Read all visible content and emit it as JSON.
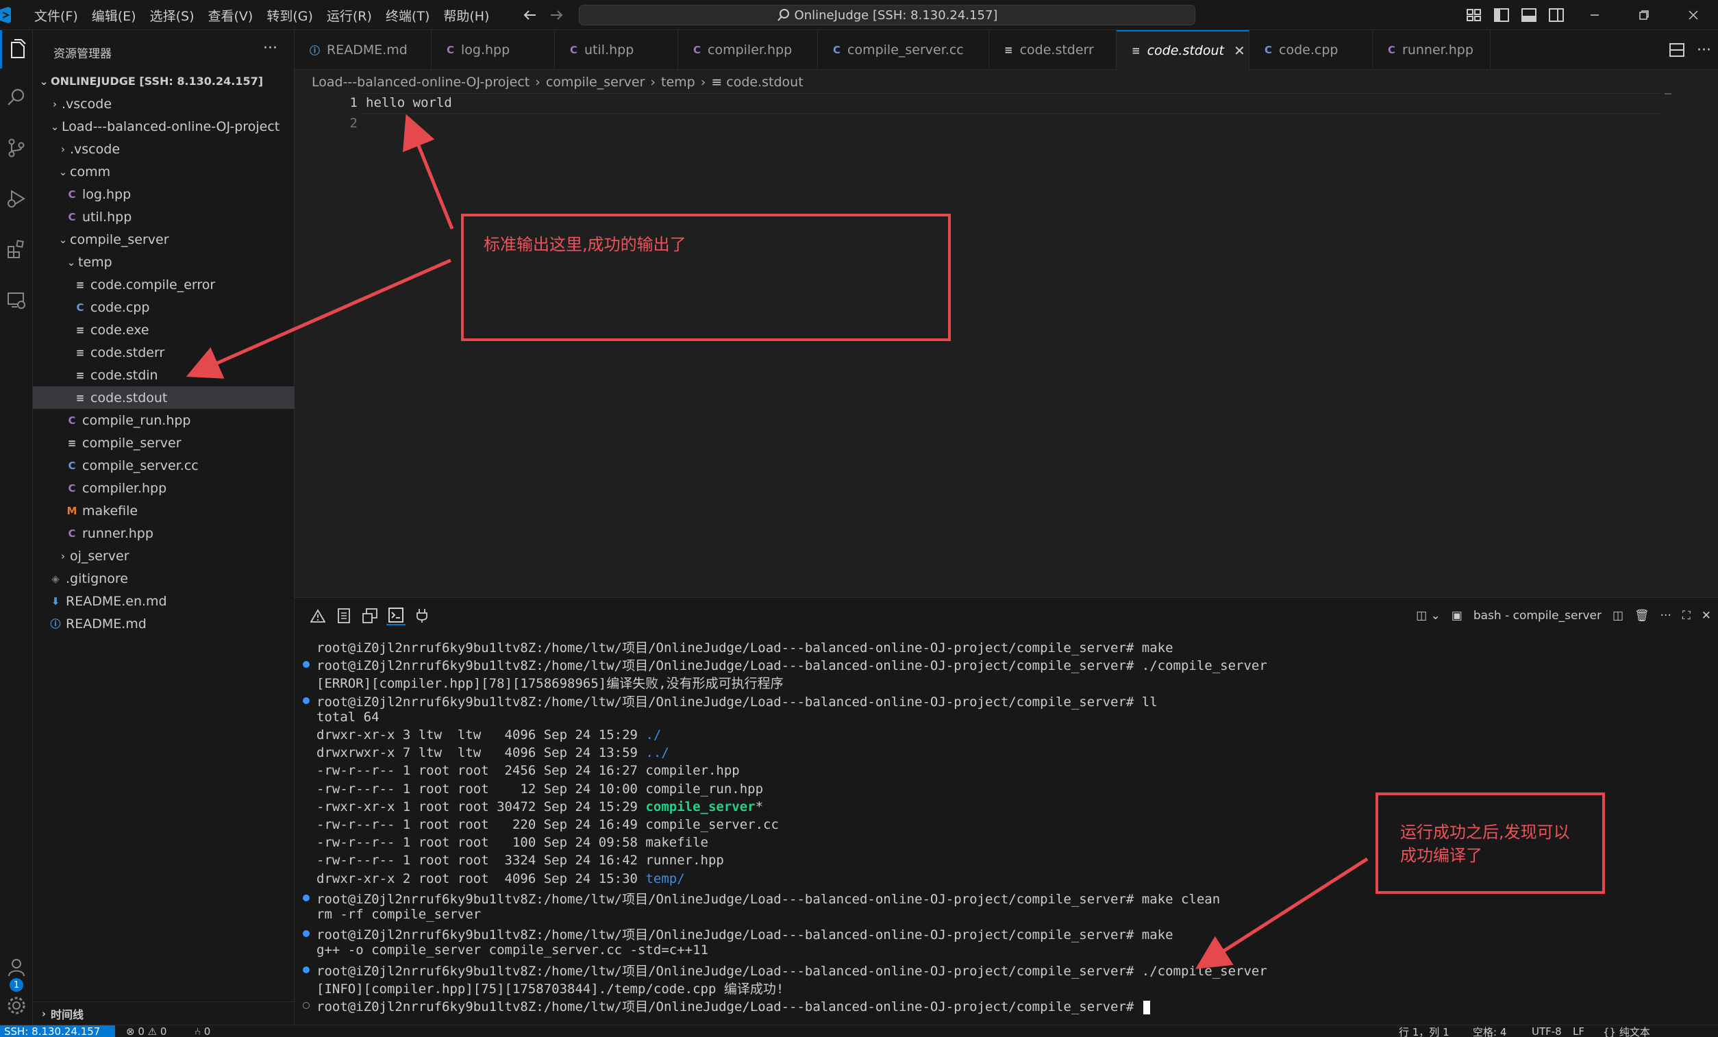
{
  "titlebar": {
    "menu": [
      "文件(F)",
      "编辑(E)",
      "选择(S)",
      "查看(V)",
      "转到(G)",
      "运行(R)",
      "终端(T)",
      "帮助(H)"
    ],
    "command_center": "OnlineJudge [SSH: 8.130.24.157]"
  },
  "sidebar": {
    "title": "资源管理器",
    "more": "···",
    "root": "ONLINEJUDGE [SSH: 8.130.24.157]",
    "items": [
      {
        "label": ".vscode",
        "kind": "folder",
        "open": false,
        "depth": 1
      },
      {
        "label": "Load---balanced-online-OJ-project",
        "kind": "folder",
        "open": true,
        "depth": 1
      },
      {
        "label": ".vscode",
        "kind": "folder",
        "open": false,
        "depth": 2
      },
      {
        "label": "comm",
        "kind": "folder",
        "open": true,
        "depth": 2
      },
      {
        "label": "log.hpp",
        "kind": "cpp-header",
        "depth": 3
      },
      {
        "label": "util.hpp",
        "kind": "cpp-header",
        "depth": 3
      },
      {
        "label": "compile_server",
        "kind": "folder",
        "open": true,
        "depth": 2
      },
      {
        "label": "temp",
        "kind": "folder",
        "open": true,
        "depth": 3
      },
      {
        "label": "code.compile_error",
        "kind": "text",
        "depth": 4
      },
      {
        "label": "code.cpp",
        "kind": "cpp",
        "depth": 4
      },
      {
        "label": "code.exe",
        "kind": "text",
        "depth": 4
      },
      {
        "label": "code.stderr",
        "kind": "text",
        "depth": 4
      },
      {
        "label": "code.stdin",
        "kind": "text",
        "depth": 4
      },
      {
        "label": "code.stdout",
        "kind": "text",
        "depth": 4,
        "selected": true
      },
      {
        "label": "compile_run.hpp",
        "kind": "cpp-header",
        "depth": 3
      },
      {
        "label": "compile_server",
        "kind": "text",
        "depth": 3
      },
      {
        "label": "compile_server.cc",
        "kind": "cpp",
        "depth": 3
      },
      {
        "label": "compiler.hpp",
        "kind": "cpp-header",
        "depth": 3
      },
      {
        "label": "makefile",
        "kind": "makefile",
        "depth": 3
      },
      {
        "label": "runner.hpp",
        "kind": "cpp-header",
        "depth": 3
      },
      {
        "label": "oj_server",
        "kind": "folder",
        "open": false,
        "depth": 2
      },
      {
        "label": ".gitignore",
        "kind": "gitignore",
        "depth": 1
      },
      {
        "label": "README.en.md",
        "kind": "readme-down",
        "depth": 1
      },
      {
        "label": "README.md",
        "kind": "info",
        "depth": 1
      }
    ],
    "timeline": "时间线"
  },
  "tabs": [
    {
      "label": "README.md",
      "kind": "info"
    },
    {
      "label": "log.hpp",
      "kind": "cpp-header"
    },
    {
      "label": "util.hpp",
      "kind": "cpp-header"
    },
    {
      "label": "compiler.hpp",
      "kind": "cpp-header"
    },
    {
      "label": "compile_server.cc",
      "kind": "cpp"
    },
    {
      "label": "code.stderr",
      "kind": "text"
    },
    {
      "label": "code.stdout",
      "kind": "text",
      "active": true
    },
    {
      "label": "code.cpp",
      "kind": "cpp"
    },
    {
      "label": "runner.hpp",
      "kind": "cpp-header"
    }
  ],
  "breadcrumb": [
    "Load---balanced-online-OJ-project",
    "compile_server",
    "temp",
    "code.stdout"
  ],
  "editor": {
    "lines": [
      {
        "num": "1",
        "text": "hello world"
      },
      {
        "num": "2",
        "text": ""
      }
    ]
  },
  "panel": {
    "terminal_name": "bash - compile_server",
    "lines": [
      {
        "text": "root@iZ0jl2nrruf6ky9bu1ltv8Z:/home/ltw/项目/OnlineJudge/Load---balanced-online-OJ-project/compile_server# make",
        "dot": "none"
      },
      {
        "text": "root@iZ0jl2nrruf6ky9bu1ltv8Z:/home/ltw/项目/OnlineJudge/Load---balanced-online-OJ-project/compile_server# ./compile_server",
        "dot": "blue"
      },
      {
        "text": "[ERROR][compiler.hpp][78][1758698965]编译失败,没有形成可执行程序",
        "dot": "none"
      },
      {
        "text": "root@iZ0jl2nrruf6ky9bu1ltv8Z:/home/ltw/项目/OnlineJudge/Load---balanced-online-OJ-project/compile_server# ll",
        "dot": "blue"
      },
      {
        "text": "total 64",
        "dot": "none"
      },
      {
        "text": "drwxr-xr-x 3 ltw  ltw   4096 Sep 24 15:29 ",
        "tail": "./",
        "tail_class": "c-blue",
        "dot": "none"
      },
      {
        "text": "drwxrwxr-x 7 ltw  ltw   4096 Sep 24 13:59 ",
        "tail": "../",
        "tail_class": "c-blue",
        "dot": "none"
      },
      {
        "text": "-rw-r--r-- 1 root root  2456 Sep 24 16:27 compiler.hpp",
        "dot": "none"
      },
      {
        "text": "-rw-r--r-- 1 root root    12 Sep 24 10:00 compile_run.hpp",
        "dot": "none"
      },
      {
        "text": "-rwxr-xr-x 1 root root 30472 Sep 24 15:29 ",
        "tail": "compile_server",
        "tail_class": "c-green",
        "tail2": "*",
        "dot": "none"
      },
      {
        "text": "-rw-r--r-- 1 root root   220 Sep 24 16:49 compile_server.cc",
        "dot": "none"
      },
      {
        "text": "-rw-r--r-- 1 root root   100 Sep 24 09:58 makefile",
        "dot": "none"
      },
      {
        "text": "-rw-r--r-- 1 root root  3324 Sep 24 16:42 runner.hpp",
        "dot": "none"
      },
      {
        "text": "drwxr-xr-x 2 root root  4096 Sep 24 15:30 ",
        "tail": "temp/",
        "tail_class": "c-blue",
        "dot": "none"
      },
      {
        "text": "root@iZ0jl2nrruf6ky9bu1ltv8Z:/home/ltw/项目/OnlineJudge/Load---balanced-online-OJ-project/compile_server# make clean",
        "dot": "blue"
      },
      {
        "text": "rm -rf compile_server",
        "dot": "none"
      },
      {
        "text": "root@iZ0jl2nrruf6ky9bu1ltv8Z:/home/ltw/项目/OnlineJudge/Load---balanced-online-OJ-project/compile_server# make",
        "dot": "blue"
      },
      {
        "text": "g++ -o compile_server compile_server.cc -std=c++11",
        "dot": "none"
      },
      {
        "text": "root@iZ0jl2nrruf6ky9bu1ltv8Z:/home/ltw/项目/OnlineJudge/Load---balanced-online-OJ-project/compile_server# ./compile_server",
        "dot": "blue"
      },
      {
        "text": "[INFO][compiler.hpp][75][1758703844]./temp/code.cpp 编译成功!",
        "dot": "none"
      },
      {
        "text": "root@iZ0jl2nrruf6ky9bu1ltv8Z:/home/ltw/项目/OnlineJudge/Load---balanced-online-OJ-project/compile_server# ",
        "dot": "hollow",
        "cursor": true
      }
    ]
  },
  "annotations": {
    "note1": "标准输出这里,成功的输出了",
    "note2_line1": "运行成功之后,发现可以",
    "note2_line2": "成功编译了"
  },
  "statusbar": {
    "remote": "SSH: 8.130.24.157",
    "problems": "⊗ 0 ⚠ 0",
    "ports": "⑃ 0",
    "position": "行 1，列 1",
    "spaces": "空格: 4",
    "encoding": "UTF-8",
    "eol": "LF",
    "language": "{} 纯文本"
  },
  "colors": {
    "accent": "#0078d4",
    "annotation": "#e5484d",
    "cpp_icon": "#6997d5",
    "hpp_icon": "#a074c4",
    "makefile_icon": "#e37933",
    "term_green": "#23d18b",
    "term_blue": "#3b8eea"
  }
}
